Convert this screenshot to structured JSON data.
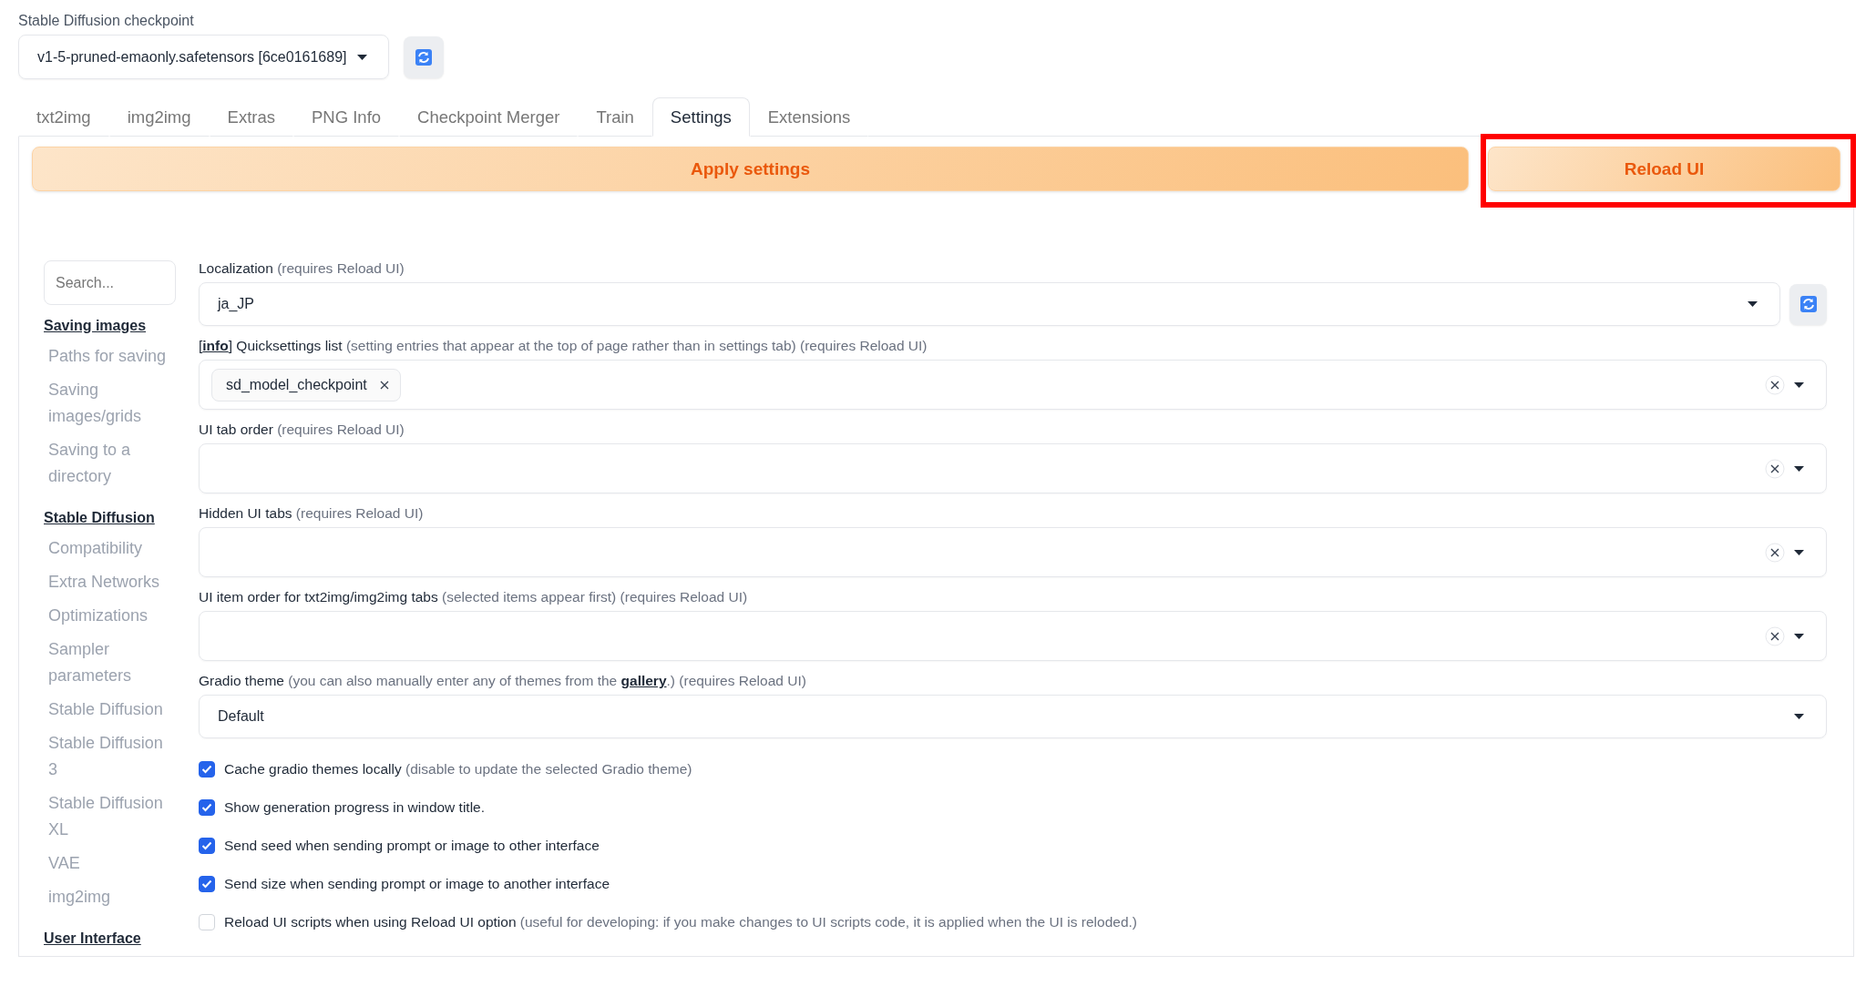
{
  "checkpoint": {
    "label": "Stable Diffusion checkpoint",
    "value": "v1-5-pruned-emaonly.safetensors [6ce0161689]"
  },
  "tabs": [
    {
      "label": "txt2img",
      "selected": false
    },
    {
      "label": "img2img",
      "selected": false
    },
    {
      "label": "Extras",
      "selected": false
    },
    {
      "label": "PNG Info",
      "selected": false
    },
    {
      "label": "Checkpoint Merger",
      "selected": false
    },
    {
      "label": "Train",
      "selected": false
    },
    {
      "label": "Settings",
      "selected": true
    },
    {
      "label": "Extensions",
      "selected": false
    }
  ],
  "actions": {
    "apply": "Apply settings",
    "reload": {
      "label": "Reload UI",
      "highlighted": true
    }
  },
  "sidebar": {
    "search_placeholder": "Search...",
    "sections": [
      {
        "title": "Saving images",
        "items": [
          "Paths for saving",
          "Saving images/grids",
          "Saving to a directory"
        ]
      },
      {
        "title": "Stable Diffusion",
        "items": [
          "Compatibility",
          "Extra Networks",
          "Optimizations",
          "Sampler parameters",
          "Stable Diffusion",
          "Stable Diffusion 3",
          "Stable Diffusion XL",
          "VAE",
          "img2img"
        ]
      },
      {
        "title": "User Interface"
      }
    ]
  },
  "settings": [
    {
      "kind": "dropdown",
      "label_parts": [
        {
          "kind": "plain",
          "text": "Localization"
        },
        {
          "kind": "note",
          "text": "(requires Reload UI)"
        }
      ],
      "value": "ja_JP",
      "refresh": true
    },
    {
      "kind": "multiselect",
      "label_parts": [
        {
          "kind": "plain",
          "text": "["
        },
        {
          "kind": "link",
          "text": "info"
        },
        {
          "kind": "plain",
          "text": "] Quicksettings list"
        },
        {
          "kind": "note",
          "text": "(setting entries that appear at the top of page rather than in settings tab) (requires Reload UI)"
        }
      ],
      "chips": [
        "sd_model_checkpoint"
      ]
    },
    {
      "kind": "multiselect",
      "label_parts": [
        {
          "kind": "plain",
          "text": "UI tab order"
        },
        {
          "kind": "note",
          "text": "(requires Reload UI)"
        }
      ]
    },
    {
      "kind": "multiselect",
      "label_parts": [
        {
          "kind": "plain",
          "text": "Hidden UI tabs"
        },
        {
          "kind": "note",
          "text": "(requires Reload UI)"
        }
      ]
    },
    {
      "kind": "multiselect",
      "label_parts": [
        {
          "kind": "plain",
          "text": "UI item order for txt2img/img2img tabs"
        },
        {
          "kind": "note",
          "text": "(selected items appear first) (requires Reload UI)"
        }
      ]
    },
    {
      "kind": "dropdown",
      "label_parts": [
        {
          "kind": "plain",
          "text": "Gradio theme"
        },
        {
          "kind": "note",
          "text": "(you can also manually enter any of themes from the"
        },
        {
          "kind": "link",
          "text": "gallery"
        },
        {
          "kind": "note",
          "text": ".) (requires Reload UI)"
        }
      ],
      "value": "Default",
      "refresh": false
    },
    {
      "kind": "checkbox",
      "label_parts": [
        {
          "kind": "plain",
          "text": "Cache gradio themes locally"
        },
        {
          "kind": "note",
          "text": "(disable to update the selected Gradio theme)"
        }
      ],
      "checked": true
    },
    {
      "kind": "checkbox",
      "label_parts": [
        {
          "kind": "plain",
          "text": "Show generation progress in window title."
        }
      ],
      "checked": true
    },
    {
      "kind": "checkbox",
      "label_parts": [
        {
          "kind": "plain",
          "text": "Send seed when sending prompt or image to other interface"
        }
      ],
      "checked": true
    },
    {
      "kind": "checkbox",
      "label_parts": [
        {
          "kind": "plain",
          "text": "Send size when sending prompt or image to another interface"
        }
      ],
      "checked": true
    },
    {
      "kind": "checkbox",
      "label_parts": [
        {
          "kind": "plain",
          "text": "Reload UI scripts when using Reload UI option"
        },
        {
          "kind": "note",
          "text": "(useful for developing: if you make changes to UI scripts code, it is applied when the UI is reloded.)"
        }
      ],
      "checked": false
    }
  ]
}
